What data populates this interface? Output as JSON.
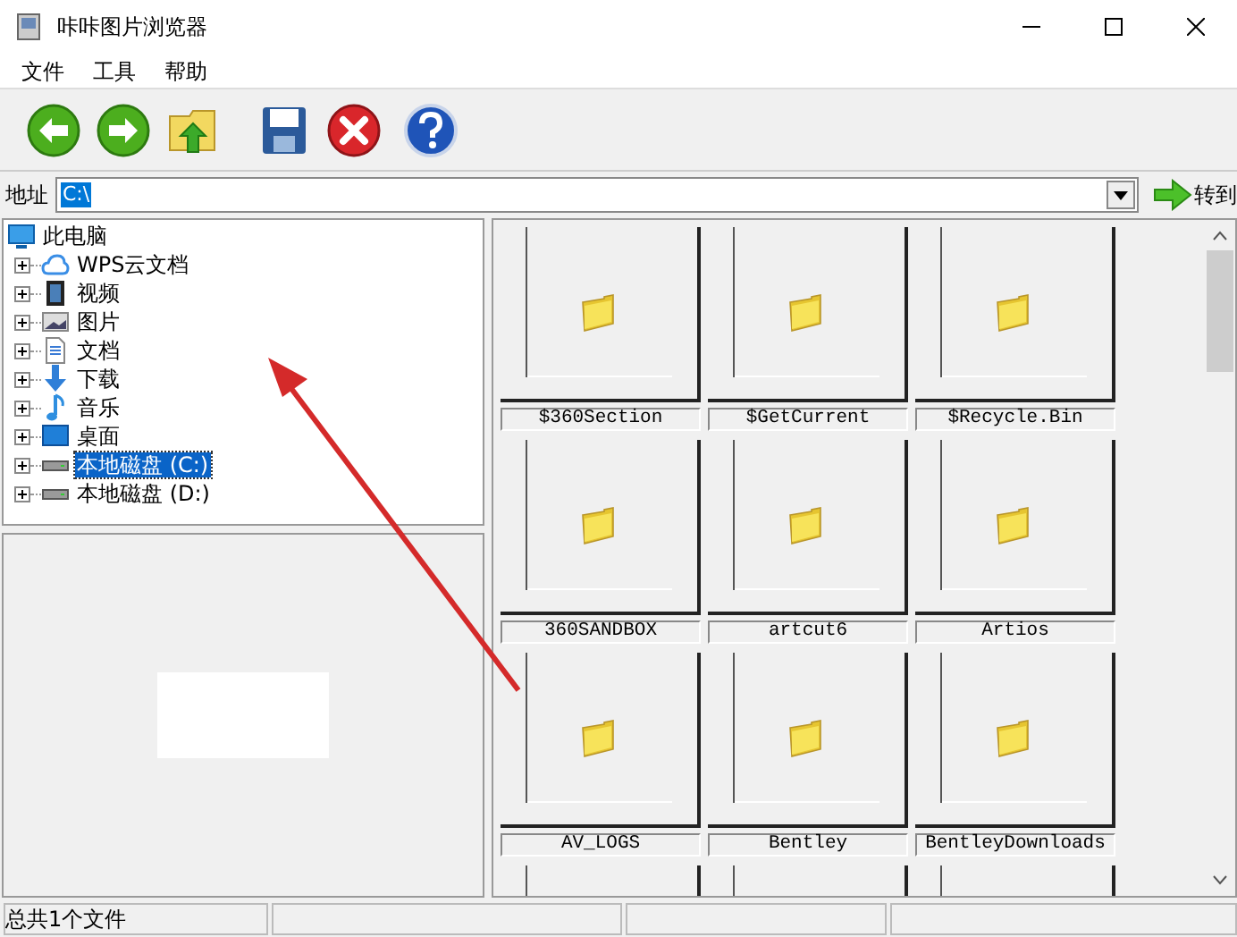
{
  "window": {
    "title": "咔咔图片浏览器"
  },
  "menu": [
    "文件",
    "工具",
    "帮助"
  ],
  "toolbar": [
    {
      "kind": "back"
    },
    {
      "kind": "forward"
    },
    {
      "kind": "up"
    },
    {
      "kind": "save"
    },
    {
      "kind": "delete"
    },
    {
      "kind": "help"
    }
  ],
  "address": {
    "label": "地址",
    "value": "C:\\",
    "go": "转到"
  },
  "tree": {
    "label": "此电脑",
    "children": [
      {
        "label": "WPS云文档",
        "kind": "cloud",
        "expanded": false,
        "selected": false
      },
      {
        "label": "视频",
        "kind": "video",
        "expanded": false,
        "selected": false
      },
      {
        "label": "图片",
        "kind": "image",
        "expanded": false,
        "selected": false
      },
      {
        "label": "文档",
        "kind": "document",
        "expanded": false,
        "selected": false
      },
      {
        "label": "下载",
        "kind": "download",
        "expanded": false,
        "selected": false
      },
      {
        "label": "音乐",
        "kind": "music",
        "expanded": false,
        "selected": false
      },
      {
        "label": "桌面",
        "kind": "desktop",
        "expanded": false,
        "selected": false
      },
      {
        "label": "本地磁盘 (C:)",
        "kind": "drive",
        "expanded": false,
        "selected": true
      },
      {
        "label": "本地磁盘 (D:)",
        "kind": "drive",
        "expanded": false,
        "selected": false
      }
    ]
  },
  "files": [
    {
      "kind": "folder",
      "name": "$360Section"
    },
    {
      "kind": "folder",
      "name": "$GetCurrent"
    },
    {
      "kind": "folder",
      "name": "$Recycle.Bin"
    },
    {
      "kind": "folder",
      "name": "360SANDBOX"
    },
    {
      "kind": "folder",
      "name": "artcut6"
    },
    {
      "kind": "folder",
      "name": "Artios"
    },
    {
      "kind": "folder",
      "name": "AV_LOGS"
    },
    {
      "kind": "folder",
      "name": "Bentley"
    },
    {
      "kind": "folder",
      "name": "BentleyDownloads"
    },
    {
      "kind": "partial"
    },
    {
      "kind": "partial"
    },
    {
      "kind": "partial"
    }
  ],
  "status_bar": [
    "总共1个文件"
  ]
}
